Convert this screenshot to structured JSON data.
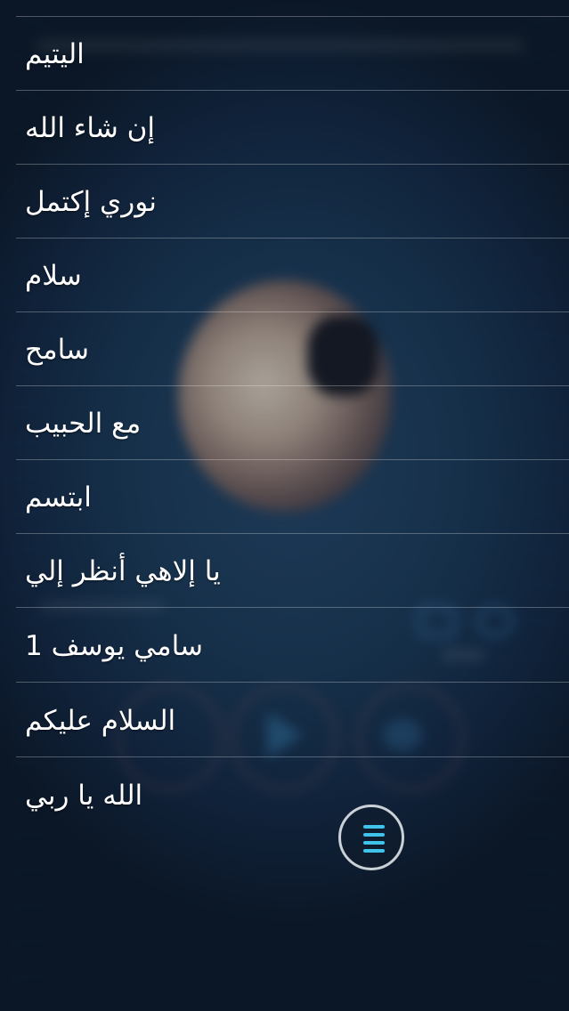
{
  "playlist": {
    "tracks": [
      {
        "title": "اليتيم"
      },
      {
        "title": "إن شاء الله"
      },
      {
        "title": "نوري إكتمل"
      },
      {
        "title": "سلام"
      },
      {
        "title": "سامح"
      },
      {
        "title": "مع الحبيب"
      },
      {
        "title": "ابتسم"
      },
      {
        "title": "يا إلاهي أنظر إلي"
      },
      {
        "title": "سامي يوسف 1"
      },
      {
        "title": "السلام عليكم"
      },
      {
        "title": "الله يا ربي"
      }
    ]
  },
  "menu_button": {
    "icon": "menu-icon",
    "color": "#3fc3ea"
  },
  "theme": {
    "background": "#10223a",
    "divider": "#ffffff",
    "text": "#ffffff"
  }
}
